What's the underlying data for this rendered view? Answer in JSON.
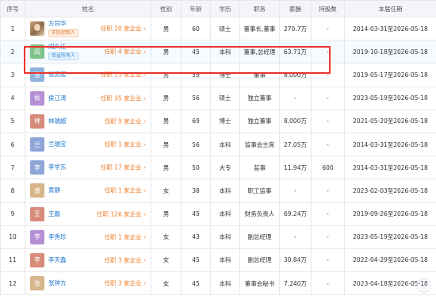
{
  "headers": {
    "index": "序号",
    "name": "姓名",
    "gender": "性别",
    "age": "年龄",
    "education": "学历",
    "position": "职务",
    "salary": "薪酬",
    "shares": "持股数",
    "term": "本届任期"
  },
  "colors": {
    "header_bg": "#f4f5fa",
    "name_link": "#1a73c9",
    "office_link": "#f07b25",
    "highlight_border": "#e8362d"
  },
  "rows": [
    {
      "index": "1",
      "avatar_text": "",
      "avatar_color": "photo",
      "name": "方同华",
      "tag": "实际控制人",
      "tag_style": "orange",
      "offices": "任职 10 家企业",
      "gender": "男",
      "age": "60",
      "education": "硕士",
      "position": "董事长,董事",
      "salary": "270.7万",
      "shares": "-",
      "term": "2014-03-31至2026-05-18"
    },
    {
      "index": "2",
      "avatar_text": "阎",
      "avatar_color": "#7cc28a",
      "name": "阎久江",
      "tag": "受益所有人",
      "tag_style": "blue",
      "offices": "任职 4 家企业",
      "gender": "男",
      "age": "45",
      "education": "本科",
      "position": "董事,总经理",
      "salary": "63.71万",
      "shares": "-",
      "term": "2019-10-18至2026-05-18"
    },
    {
      "index": "3",
      "avatar_text": "张",
      "avatar_color": "#8fb2df",
      "name": "张云起",
      "tag": "",
      "tag_style": "",
      "offices": "任职 11 家企业",
      "gender": "男",
      "age": "59",
      "education": "博士",
      "position": "董事",
      "salary": "8.000万",
      "shares": "-",
      "term": "2019-05-17至2026-05-18"
    },
    {
      "index": "4",
      "avatar_text": "侯",
      "avatar_color": "#b48fd4",
      "name": "侯江涛",
      "tag": "",
      "tag_style": "",
      "offices": "任职 35 家企业",
      "gender": "男",
      "age": "56",
      "education": "硕士",
      "position": "独立董事",
      "salary": "-",
      "shares": "-",
      "term": "2023-05-19至2026-05-18"
    },
    {
      "index": "5",
      "avatar_text": "林",
      "avatar_color": "#d98b7a",
      "name": "林瑞超",
      "tag": "",
      "tag_style": "",
      "offices": "任职 9 家企业",
      "gender": "男",
      "age": "69",
      "education": "博士",
      "position": "独立董事",
      "salary": "8.000万",
      "shares": "-",
      "term": "2021-05-20至2026-05-18"
    },
    {
      "index": "6",
      "avatar_text": "兰",
      "avatar_color": "#8fa6d8",
      "name": "兰瑞宝",
      "tag": "",
      "tag_style": "",
      "offices": "任职 1 家企业",
      "gender": "男",
      "age": "56",
      "education": "本科",
      "position": "监事会主席",
      "salary": "27.05万",
      "shares": "-",
      "term": "2014-03-31至2026-05-18"
    },
    {
      "index": "7",
      "avatar_text": "李",
      "avatar_color": "#8fa6d8",
      "name": "李学东",
      "tag": "",
      "tag_style": "",
      "offices": "任职 17 家企业",
      "gender": "男",
      "age": "50",
      "education": "大专",
      "position": "监事",
      "salary": "11.94万",
      "shares": "600",
      "term": "2014-03-31至2026-05-18"
    },
    {
      "index": "8",
      "avatar_text": "黄",
      "avatar_color": "#d8b58a",
      "name": "黄静",
      "tag": "",
      "tag_style": "",
      "offices": "任职 1 家企业",
      "gender": "女",
      "age": "38",
      "education": "本科",
      "position": "职工监事",
      "salary": "-",
      "shares": "-",
      "term": "2023-02-03至2026-05-18"
    },
    {
      "index": "9",
      "avatar_text": "王",
      "avatar_color": "#d98b7a",
      "name": "王磊",
      "tag": "",
      "tag_style": "",
      "offices": "任职 126 家企业",
      "gender": "男",
      "age": "45",
      "education": "本科",
      "position": "财务负责人",
      "salary": "69.24万",
      "shares": "-",
      "term": "2019-09-26至2026-05-18"
    },
    {
      "index": "10",
      "avatar_text": "李",
      "avatar_color": "#b48fd4",
      "name": "李秀珍",
      "tag": "",
      "tag_style": "",
      "offices": "任职 1 家企业",
      "gender": "女",
      "age": "43",
      "education": "本科",
      "position": "副总经理",
      "salary": "-",
      "shares": "-",
      "term": "2023-05-19至2026-05-18"
    },
    {
      "index": "11",
      "avatar_text": "李",
      "avatar_color": "#d98b7a",
      "name": "李天鑫",
      "tag": "",
      "tag_style": "",
      "offices": "任职 3 家企业",
      "gender": "女",
      "age": "45",
      "education": "本科",
      "position": "副总经理",
      "salary": "30.84万",
      "shares": "-",
      "term": "2022-04-29至2026-05-18"
    },
    {
      "index": "12",
      "avatar_text": "张",
      "avatar_color": "#d8b58a",
      "name": "张钟方",
      "tag": "",
      "tag_style": "",
      "offices": "任职 3 家企业",
      "gender": "女",
      "age": "45",
      "education": "本科",
      "position": "董事会秘书",
      "salary": "7.240万",
      "shares": "-",
      "term": "2023-04-18至2026-05-18"
    }
  ],
  "watermark": {
    "text": "ⓘ"
  }
}
